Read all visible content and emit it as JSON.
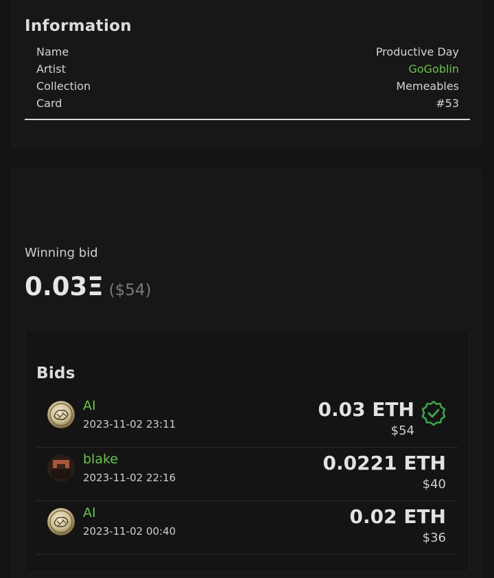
{
  "information": {
    "title": "Information",
    "rows": [
      {
        "label": "Name",
        "value": "Productive Day"
      },
      {
        "label": "Artist",
        "value": "GoGoblin"
      },
      {
        "label": "Collection",
        "value": "Memeables"
      },
      {
        "label": "Card",
        "value": "#53"
      }
    ]
  },
  "winning_bid": {
    "label": "Winning bid",
    "amount": "0.03Ξ",
    "usd": "($54)"
  },
  "bids": {
    "title": "Bids",
    "items": [
      {
        "user": "AI",
        "time": "2023-11-02 23:11",
        "eth": "0.03 ETH",
        "usd": "$54",
        "winner": true,
        "avatar": "coin-avatar"
      },
      {
        "user": "blake",
        "time": "2023-11-02 22:16",
        "eth": "0.0221 ETH",
        "usd": "$40",
        "winner": false,
        "avatar": "goblin-avatar"
      },
      {
        "user": "AI",
        "time": "2023-11-02 00:40",
        "eth": "0.02 ETH",
        "usd": "$36",
        "winner": false,
        "avatar": "coin-avatar"
      }
    ]
  },
  "colors": {
    "accent_green": "#6cc34f",
    "background": "#141414",
    "card": "#171717"
  }
}
